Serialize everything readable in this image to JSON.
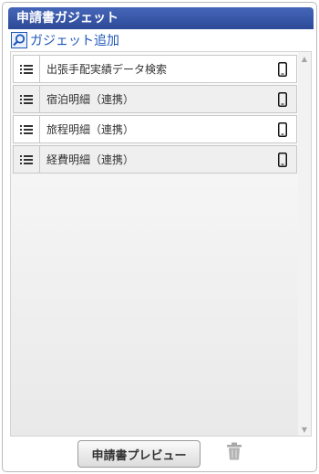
{
  "header": {
    "title": "申請書ガジェット"
  },
  "toolbar": {
    "add_gadget_label": "ガジェット追加",
    "add_gadget_icon": "magnifier-icon"
  },
  "gadgets": [
    {
      "label": "出張手配実績データ検索",
      "handle_icon": "list-drag-icon",
      "device_icon": "smartphone-icon"
    },
    {
      "label": "宿泊明細（連携）",
      "handle_icon": "list-drag-icon",
      "device_icon": "smartphone-icon"
    },
    {
      "label": "旅程明細（連携）",
      "handle_icon": "list-drag-icon",
      "device_icon": "smartphone-icon"
    },
    {
      "label": "経費明細（連携）",
      "handle_icon": "list-drag-icon",
      "device_icon": "smartphone-icon"
    }
  ],
  "footer": {
    "preview_label": "申請書プレビュー",
    "delete_icon": "trash-icon"
  },
  "colors": {
    "header": "#2c4a97",
    "link": "#1d56b8"
  }
}
